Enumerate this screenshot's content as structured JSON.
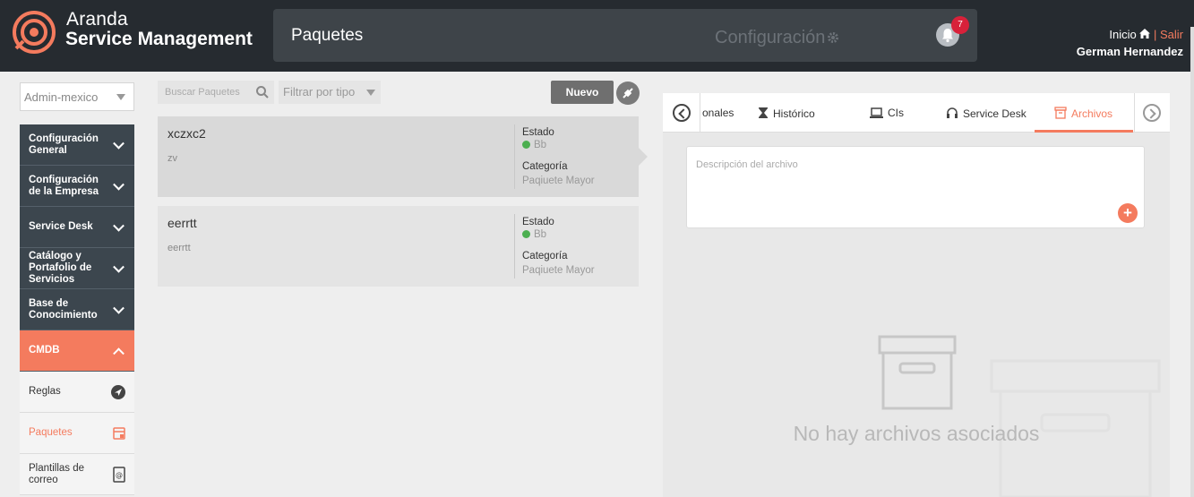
{
  "brand": {
    "line1": "Aranda",
    "line2": "Service Management"
  },
  "header": {
    "title": "Paquetes",
    "config_label": "Configuración",
    "notification_count": "7",
    "home_label": "Inicio",
    "separator": "|",
    "logout_label": "Salir",
    "user_name": "German Hernandez"
  },
  "sidebar": {
    "tenant": "Admin-mexico",
    "items": [
      {
        "label": "Configuración General"
      },
      {
        "label": "Configuración de la Empresa"
      },
      {
        "label": "Service Desk"
      },
      {
        "label": "Catálogo y Portafolio de Servicios"
      },
      {
        "label": "Base de Conocimiento"
      },
      {
        "label": "CMDB"
      }
    ],
    "subitems": [
      {
        "label": "Reglas",
        "icon": "compass-icon"
      },
      {
        "label": "Paquetes",
        "icon": "package-icon"
      },
      {
        "label": "Plantillas de correo",
        "icon": "email-template-icon"
      }
    ]
  },
  "toolbar": {
    "search_placeholder": "Buscar Paquetes",
    "filter_label": "Filtrar por tipo",
    "new_label": "Nuevo"
  },
  "packages": [
    {
      "name": "xczxc2",
      "description": "zv",
      "status_label": "Estado",
      "status": "Bb",
      "category_label": "Categoría",
      "category": "Paqiuete Mayor"
    },
    {
      "name": "eerrtt",
      "description": "eerrtt",
      "status_label": "Estado",
      "status": "Bb",
      "category_label": "Categoría",
      "category": "Paqiuete Mayor"
    }
  ],
  "detail": {
    "tabs": [
      {
        "label": "onales",
        "icon": ""
      },
      {
        "label": "Histórico",
        "icon": "hourglass-icon"
      },
      {
        "label": "CIs",
        "icon": "computer-icon"
      },
      {
        "label": "Service Desk",
        "icon": "headset-icon"
      },
      {
        "label": "Archivos",
        "icon": "archive-icon",
        "active": true
      }
    ],
    "file_description_placeholder": "Descripción del archivo",
    "add_symbol": "+",
    "empty_message": "No hay archivos asociados"
  },
  "colors": {
    "accent": "#f47b5e",
    "header_bg": "#262b30",
    "menu_bg": "#3c464e",
    "status_green": "#4caf50"
  }
}
